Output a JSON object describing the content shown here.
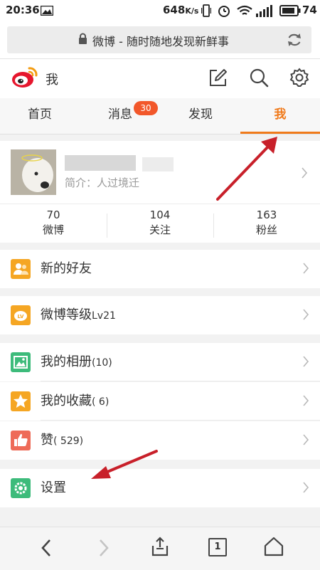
{
  "status_bar": {
    "time": "20:36",
    "speed": "648",
    "speed_unit": "K/s",
    "battery": "74"
  },
  "browser": {
    "url_title": "微博 - 随时随地发现新鲜事"
  },
  "header": {
    "title": "我"
  },
  "tabs": [
    {
      "label": "首页"
    },
    {
      "label": "消息",
      "badge": "30"
    },
    {
      "label": "发现"
    },
    {
      "label": "我",
      "active": true
    }
  ],
  "profile": {
    "bio": "简介：人过境迁"
  },
  "stats": [
    {
      "value": "70",
      "label": "微博"
    },
    {
      "value": "104",
      "label": "关注"
    },
    {
      "value": "163",
      "label": "粉丝"
    }
  ],
  "menu": [
    {
      "label": "新的好友",
      "suffix": "",
      "icon": "new-friends-icon",
      "color": "#f5a623"
    },
    {
      "label": "微博等级",
      "suffix": "Lv21",
      "icon": "weibo-level-icon",
      "color": "#f5a623"
    },
    {
      "label": "我的相册",
      "suffix": "(10)",
      "icon": "album-icon",
      "color": "#3dbb7b"
    },
    {
      "label": "我的收藏",
      "suffix": "( 6)",
      "icon": "favorites-icon",
      "color": "#f5a623"
    },
    {
      "label": "赞",
      "suffix": "( 529)",
      "icon": "like-icon",
      "color": "#ee6b58"
    },
    {
      "label": "设置",
      "suffix": "",
      "icon": "settings-icon",
      "color": "#3dbb7b"
    }
  ],
  "bottom_nav": {
    "tab_count": "1"
  },
  "colors": {
    "accent": "#f07a1b",
    "badge": "#f2572a",
    "arrow": "#c8202a"
  }
}
